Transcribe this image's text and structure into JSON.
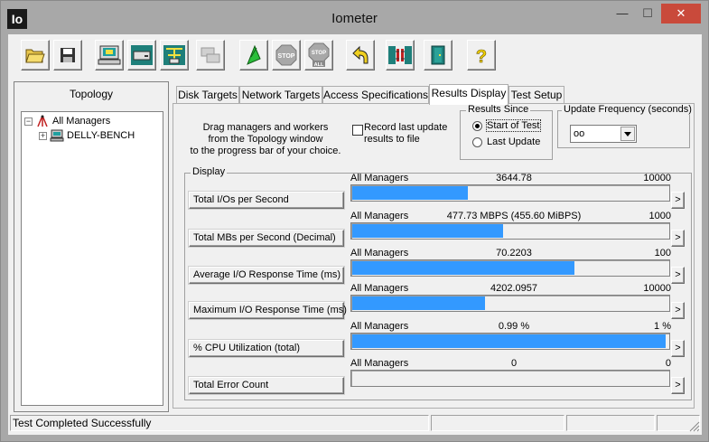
{
  "window": {
    "title": "Iometer",
    "app_icon_text": "Io",
    "minimize_glyph": "—",
    "maximize_glyph": "☐",
    "close_glyph": "✕"
  },
  "toolbar": {
    "buttons": [
      {
        "name": "open-config-button",
        "icon": "open-folder-icon"
      },
      {
        "name": "save-config-button",
        "icon": "floppy-disk-icon"
      },
      {
        "name": "show-results-button",
        "icon": "computer-icon"
      },
      {
        "name": "new-disk-worker-button",
        "icon": "disk-worker-icon"
      },
      {
        "name": "new-network-worker-button",
        "icon": "network-worker-icon"
      },
      {
        "name": "duplicate-worker-button",
        "icon": "duplicate-worker-icon"
      },
      {
        "name": "start-tests-button",
        "icon": "green-flag-icon"
      },
      {
        "name": "stop-test-button",
        "icon": "stop-sign-icon",
        "label": "STOP"
      },
      {
        "name": "stop-all-button",
        "icon": "stop-all-icon",
        "label": "STOP",
        "sublabel": "ALL"
      },
      {
        "name": "reset-workers-button",
        "icon": "reset-arrow-icon"
      },
      {
        "name": "exit-manager-button",
        "icon": "disconnect-icon"
      },
      {
        "name": "exit-button",
        "icon": "exit-door-icon"
      },
      {
        "name": "about-button",
        "icon": "question-mark-icon",
        "label": "?"
      }
    ]
  },
  "topology": {
    "title": "Topology",
    "root": {
      "label": "All Managers",
      "expander": "−"
    },
    "children": [
      {
        "label": "DELLY-BENCH",
        "expander": "+"
      }
    ]
  },
  "tabs": [
    {
      "label": "Disk Targets",
      "active": false
    },
    {
      "label": "Network Targets",
      "active": false
    },
    {
      "label": "Access Specifications",
      "active": false
    },
    {
      "label": "Results Display",
      "active": true
    },
    {
      "label": "Test Setup",
      "active": false
    }
  ],
  "results": {
    "drag_hint_line1": "Drag managers and workers",
    "drag_hint_line2": "from the Topology window",
    "drag_hint_line3": "to the progress bar of your choice.",
    "record_line1": "Record last update",
    "record_line2": "results to file",
    "record_checked": false,
    "results_since": {
      "title": "Results Since",
      "options": [
        {
          "label": "Start of Test",
          "selected": true
        },
        {
          "label": "Last Update",
          "selected": false
        }
      ]
    },
    "update_frequency": {
      "title": "Update Frequency (seconds)",
      "value": "oo"
    },
    "display_title": "Display",
    "more_glyph": ">",
    "metrics": [
      {
        "button": "Total I/Os per Second",
        "source": "All Managers",
        "value": "3644.78",
        "max": "10000",
        "fraction": 0.3645
      },
      {
        "button": "Total MBs per Second (Decimal)",
        "source": "All Managers",
        "value": "477.73 MBPS (455.60 MiBPS)",
        "max": "1000",
        "fraction": 0.4777
      },
      {
        "button": "Average I/O Response Time (ms)",
        "source": "All Managers",
        "value": "70.2203",
        "max": "100",
        "fraction": 0.7022
      },
      {
        "button": "Maximum I/O Response Time (ms)",
        "source": "All Managers",
        "value": "4202.0957",
        "max": "10000",
        "fraction": 0.4202
      },
      {
        "button": "% CPU Utilization (total)",
        "source": "All Managers",
        "value": "0.99 %",
        "max": "1 %",
        "fraction": 0.99
      },
      {
        "button": "Total Error Count",
        "source": "All Managers",
        "value": "0",
        "max": "0",
        "fraction": 0
      }
    ]
  },
  "status": {
    "message": "Test Completed Successfully",
    "cells": [
      "",
      "",
      ""
    ]
  },
  "colors": {
    "bar_fill": "#3399ff",
    "close_button": "#c94a3b",
    "window_frame": "#a8a8a8"
  }
}
